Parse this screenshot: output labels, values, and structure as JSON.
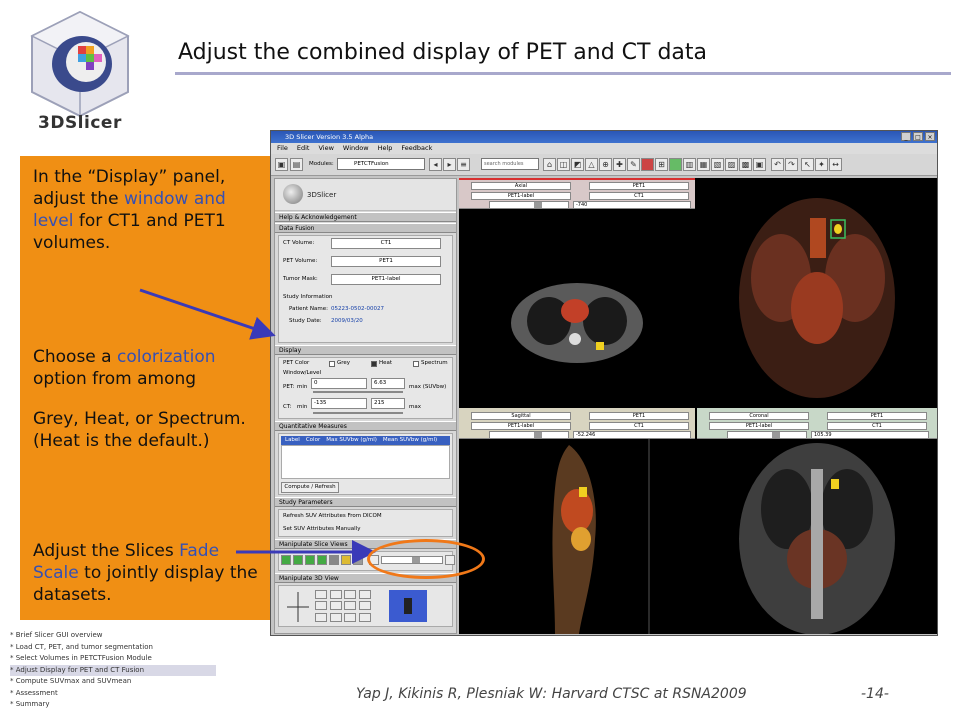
{
  "slide": {
    "title": "Adjust the combined display of PET and CT data",
    "logo_text": "3DSlicer",
    "footer": "Yap J, Kikinis R, Plesniak W: Harvard CTSC at RSNA2009",
    "page_number": "-14-"
  },
  "callout": {
    "p1_a": "In the “Display” panel, adjust the ",
    "p1_hl": "window and level",
    "p1_b": " for CT1 and PET1 volumes.",
    "p2_a": "Choose a ",
    "p2_hl": "colorization",
    "p2_b": " option from among",
    "p3": "Grey, Heat, or Spectrum. (Heat is the default.)",
    "p4_a": "Adjust the Slices ",
    "p4_hl": "Fade Scale",
    "p4_b": " to jointly display the datasets."
  },
  "nav": {
    "items": [
      "* Brief Slicer GUI overview",
      "* Load CT, PET, and tumor segmentation",
      "* Select Volumes in PETCTFusion Module",
      "* Adjust Display for PET and CT Fusion",
      "* Compute SUVmax and SUVmean",
      "* Assessment",
      "* Summary"
    ],
    "active_index": 3
  },
  "app": {
    "window_title": "3D Slicer Version 3.5 Alpha",
    "menu": [
      "File",
      "Edit",
      "View",
      "Window",
      "Help",
      "Feedback"
    ],
    "modules_label": "Modules:",
    "module_selected": "PETCTFusion",
    "search_placeholder": "search modules",
    "brand": "3DSlicer",
    "sections": {
      "help": "Help & Acknowledgement",
      "fusion": "Data Fusion",
      "display": "Display",
      "quant": "Quantitative Measures",
      "study": "Study Parameters",
      "slice_views": "Manipulate Slice Views",
      "view3d": "Manipulate 3D View"
    },
    "fusion": {
      "ct_label": "CT Volume:",
      "ct_value": "CT1",
      "pet_label": "PET Volume:",
      "pet_value": "PET1",
      "mask_label": "Tumor Mask:",
      "mask_value": "PET1-label",
      "study_info": "Study Information",
      "patient_label": "Patient Name:",
      "patient_value": "05223-0502-00027",
      "date_label": "Study Date:",
      "date_value": "2009/03/20"
    },
    "display": {
      "pet_color": "PET Color",
      "grey": "Grey",
      "heat": "Heat",
      "spectrum": "Spectrum",
      "window_level": "Window/Level",
      "pet_label": "PET:",
      "min": "min",
      "pet_min": "0",
      "pet_max": "6.63",
      "pet_unit": "max (SUVbw)",
      "ct_label": "CT:",
      "ct_min": "-135",
      "ct_max": "215",
      "max": "max"
    },
    "quant": {
      "columns": [
        "Label",
        "Color",
        "Max SUVbw (g/ml)",
        "Mean SUVbw (g/ml)"
      ],
      "compute": "Compute / Refresh"
    },
    "study": {
      "refresh": "Refresh SUV Attributes From DICOM",
      "manual": "Set SUV Attributes Manually"
    },
    "views": {
      "axial": {
        "orientation": "Axial",
        "bg": "PET1",
        "label": "PET1-label",
        "fg": "CT1",
        "offset": "-740"
      },
      "sagittal": {
        "orientation": "Sagittal",
        "bg": "PET1",
        "label": "PET1-label",
        "fg": "CT1",
        "offset": "-52.246"
      },
      "coronal": {
        "orientation": "Coronal",
        "bg": "PET1",
        "label": "PET1-label",
        "fg": "CT1",
        "offset": "105.39"
      }
    }
  },
  "colors": {
    "callout_bg": "#f08f14",
    "highlight": "#3550b4",
    "fade_circle": "#f07818",
    "arrow": "#3a3ab8"
  }
}
